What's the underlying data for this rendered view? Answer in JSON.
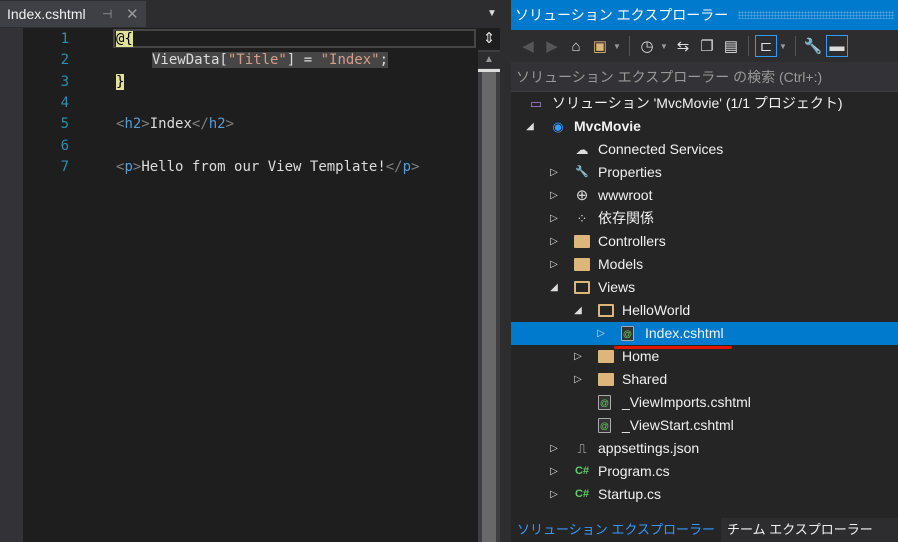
{
  "editor": {
    "tab_label": "Index.cshtml",
    "pin_icon": "pin-icon",
    "close_icon": "close-icon",
    "lines": [
      {
        "num": "1",
        "parts": [
          "@{"
        ]
      },
      {
        "num": "2",
        "parts": [
          "ViewData[",
          "\"Title\"",
          "] = ",
          "\"Index\"",
          ";"
        ]
      },
      {
        "num": "3",
        "parts": [
          "}"
        ]
      },
      {
        "num": "4",
        "parts": []
      },
      {
        "num": "5",
        "parts": [
          "<",
          "h2",
          ">",
          "Index",
          "</",
          "h2",
          ">"
        ]
      },
      {
        "num": "6",
        "parts": []
      },
      {
        "num": "7",
        "parts": [
          "<",
          "p",
          ">",
          "Hello from our View Template!",
          "</",
          "p",
          ">"
        ]
      }
    ]
  },
  "solution_explorer": {
    "title": "ソリューション エクスプローラー",
    "search_placeholder": "ソリューション エクスプローラー の検索 (Ctrl+:)",
    "toolbar": [
      "back-icon",
      "forward-icon",
      "home-icon",
      "switch-views-icon",
      "pending-changes-filter-icon",
      "sync-icon",
      "collapse-all-icon",
      "show-all-files-icon",
      "preview-selected-icon",
      "properties-icon",
      "pin-icon"
    ],
    "tree": [
      {
        "label": "ソリューション 'MvcMovie' (1/1 プロジェクト)",
        "level": 0,
        "icon": "solution-icon",
        "arrow": ""
      },
      {
        "label": "MvcMovie",
        "level": 1,
        "icon": "web-project-icon",
        "arrow": "expanded",
        "bold": true
      },
      {
        "label": "Connected Services",
        "level": 2,
        "icon": "cloud-icon",
        "arrow": ""
      },
      {
        "label": "Properties",
        "level": 2,
        "icon": "wrench-icon",
        "arrow": "collapsed"
      },
      {
        "label": "wwwroot",
        "level": 2,
        "icon": "globe-icon",
        "arrow": "collapsed"
      },
      {
        "label": "依存関係",
        "level": 2,
        "icon": "dependencies-icon",
        "arrow": "collapsed"
      },
      {
        "label": "Controllers",
        "level": 2,
        "icon": "folder-icon",
        "arrow": "collapsed"
      },
      {
        "label": "Models",
        "level": 2,
        "icon": "folder-icon",
        "arrow": "collapsed"
      },
      {
        "label": "Views",
        "level": 2,
        "icon": "folder-open-icon",
        "arrow": "expanded"
      },
      {
        "label": "HelloWorld",
        "level": 3,
        "icon": "folder-open-icon",
        "arrow": "expanded"
      },
      {
        "label": "Index.cshtml",
        "level": 4,
        "icon": "razor-file-icon",
        "arrow": "collapsed",
        "selected": true
      },
      {
        "label": "Home",
        "level": 3,
        "icon": "folder-icon",
        "arrow": "collapsed"
      },
      {
        "label": "Shared",
        "level": 3,
        "icon": "folder-icon",
        "arrow": "collapsed"
      },
      {
        "label": "_ViewImports.cshtml",
        "level": 3,
        "icon": "razor-file-icon",
        "arrow": ""
      },
      {
        "label": "_ViewStart.cshtml",
        "level": 3,
        "icon": "razor-file-icon",
        "arrow": ""
      },
      {
        "label": "appsettings.json",
        "level": 2,
        "icon": "json-file-icon",
        "arrow": "collapsed"
      },
      {
        "label": "Program.cs",
        "level": 2,
        "icon": "csharp-file-icon",
        "arrow": "collapsed"
      },
      {
        "label": "Startup.cs",
        "level": 2,
        "icon": "csharp-file-icon",
        "arrow": "collapsed"
      }
    ],
    "bottom_tabs": [
      "ソリューション エクスプローラー",
      "チーム エクスプローラー"
    ]
  },
  "colors": {
    "accent": "#007acc",
    "highlight_underline": "#e51400"
  }
}
